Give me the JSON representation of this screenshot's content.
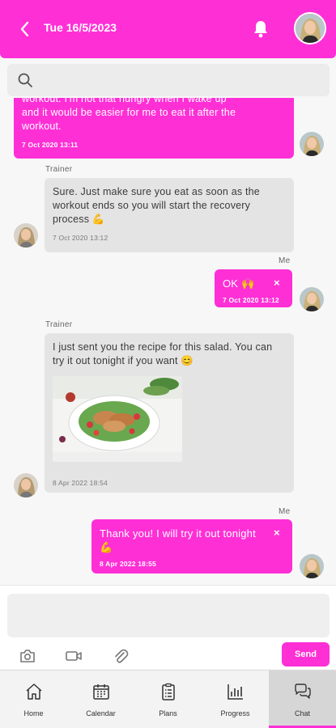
{
  "header": {
    "title": "Tue 16/5/2023",
    "back_icon": "chevron-left-icon",
    "bell_icon": "bell-icon",
    "bg_color": "#ff2fd6"
  },
  "search": {
    "placeholder": "",
    "icon": "search-icon"
  },
  "messages": [
    {
      "from": "me",
      "text_lines": [
        "workout. I'm not that hungry when I wake up",
        "and it would be easier for me to eat it after the",
        "workout."
      ],
      "time": "7 Oct 2020 13:11"
    },
    {
      "from": "trainer",
      "sender": "Trainer",
      "text": "Sure. Just make sure you eat as soon as the workout ends so you will start the recovery process 💪",
      "time": "7 Oct 2020 13:12"
    },
    {
      "from": "me",
      "sender": "Me",
      "text": "OK 🙌",
      "close": "×",
      "time": "7 Oct 2020 13:12"
    },
    {
      "from": "trainer",
      "sender": "Trainer",
      "text": "I just sent you the recipe for this salad. You can try it out tonight if you want 😊",
      "attachment": "salad-photo",
      "time": "8 Apr 2022 18:54"
    },
    {
      "from": "me",
      "sender": "Me",
      "text": "Thank you! I will try it out tonight 💪",
      "close": "×",
      "time": "8 Apr 2022 18:55"
    }
  ],
  "compose": {
    "placeholder": "",
    "camera_icon": "camera-icon",
    "video_icon": "video-camera-icon",
    "attach_icon": "paperclip-icon",
    "send_label": "Send"
  },
  "nav": {
    "items": [
      {
        "label": "Home",
        "icon": "home-icon"
      },
      {
        "label": "Calendar",
        "icon": "calendar-icon"
      },
      {
        "label": "Plans",
        "icon": "clipboard-icon"
      },
      {
        "label": "Progress",
        "icon": "bar-chart-icon"
      },
      {
        "label": "Chat",
        "icon": "chat-bubbles-icon",
        "active": true
      }
    ]
  },
  "colors": {
    "accent": "#ff2fd6",
    "trainer_bubble": "#e4e4e4"
  }
}
